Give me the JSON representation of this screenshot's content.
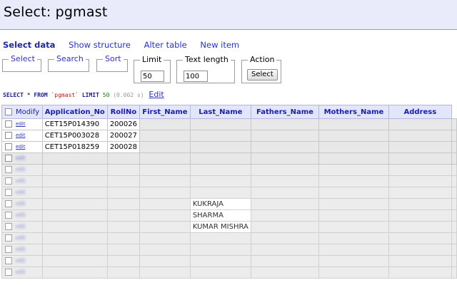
{
  "page": {
    "title": "Select: pgmast"
  },
  "menu": {
    "items": [
      {
        "label": "Select data",
        "active": true
      },
      {
        "label": "Show structure",
        "active": false
      },
      {
        "label": "Alter table",
        "active": false
      },
      {
        "label": "New item",
        "active": false
      }
    ]
  },
  "controls": {
    "select_label": "Select",
    "search_label": "Search",
    "sort_label": "Sort",
    "limit_label": "Limit",
    "limit_value": "50",
    "text_length_label": "Text length",
    "text_length_value": "100",
    "action_label": "Action",
    "action_button": "Select"
  },
  "query": {
    "kw_select": "SELECT",
    "star": "*",
    "kw_from": "FROM",
    "table": "`pgmast`",
    "kw_limit": "LIMIT",
    "limit": "50",
    "time": "(0.002 s)",
    "edit_label": "Edit"
  },
  "table": {
    "modify_label": "Modify",
    "edit_link": "edit",
    "headers": [
      "Application_No",
      "RollNo",
      "First_Name",
      "Last_Name",
      "Fathers_Name",
      "Mothers_Name",
      "Address"
    ],
    "rows": [
      [
        "CET15P014390",
        "200026",
        "",
        "",
        "",
        "",
        ""
      ],
      [
        "CET15P003028",
        "200027",
        "",
        "",
        "",
        "",
        ""
      ],
      [
        "CET15P018259",
        "200028",
        "",
        "",
        "",
        "",
        ""
      ],
      [
        "",
        "",
        "",
        "",
        "",
        "",
        ""
      ],
      [
        "",
        "",
        "",
        "",
        "",
        "",
        ""
      ],
      [
        "",
        "",
        "",
        "",
        "",
        "",
        ""
      ],
      [
        "",
        "",
        "",
        "",
        "",
        "",
        ""
      ],
      [
        "",
        "",
        "",
        "KUKRAJA",
        "",
        "",
        ""
      ],
      [
        "",
        "",
        "",
        "SHARMA",
        "",
        "",
        ""
      ],
      [
        "",
        "",
        "",
        "KUMAR MISHRA",
        "",
        "",
        ""
      ],
      [
        "",
        "",
        "",
        "",
        "",
        "",
        ""
      ],
      [
        "",
        "",
        "",
        "",
        "",
        "",
        ""
      ],
      [
        "",
        "",
        "",
        "",
        "",
        "",
        ""
      ],
      [
        "",
        "",
        "",
        "",
        "",
        "",
        ""
      ]
    ]
  },
  "colors": {
    "header_bg": "#e9ebfb",
    "link": "#2b34b8",
    "th_bg": "#e3e5fa",
    "th_text": "#1a22a0"
  }
}
